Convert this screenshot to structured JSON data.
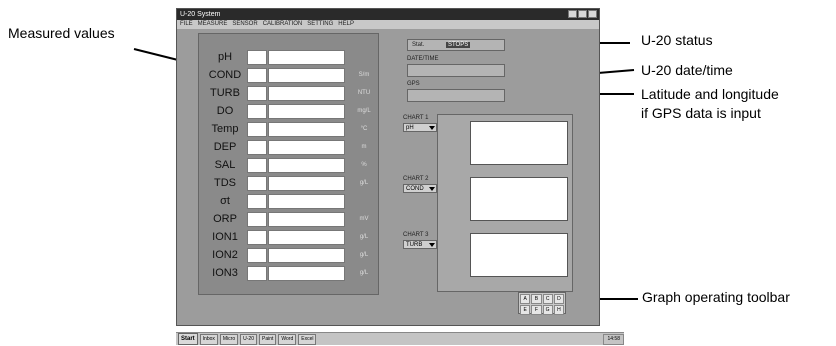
{
  "annotations": {
    "measured_values": "Measured values",
    "u20_status": "U-20 status",
    "u20_datetime": "U-20 date/time",
    "gps_line1": "Latitude and longitude",
    "gps_line2": "if GPS data is input",
    "toolbar": "Graph operating toolbar"
  },
  "window": {
    "title": "U-20 System",
    "menu": [
      "FILE",
      "MEASURE",
      "SENSOR",
      "CALIBRATION",
      "SETTING",
      "HELP"
    ]
  },
  "parameters": [
    {
      "label": "pH",
      "unit": ""
    },
    {
      "label": "COND",
      "unit": "S/m"
    },
    {
      "label": "TURB",
      "unit": "NTU"
    },
    {
      "label": "DO",
      "unit": "mg/L"
    },
    {
      "label": "Temp",
      "unit": "°C"
    },
    {
      "label": "DEP",
      "unit": "m"
    },
    {
      "label": "SAL",
      "unit": "%"
    },
    {
      "label": "TDS",
      "unit": "g/L"
    },
    {
      "label": "σt",
      "unit": ""
    },
    {
      "label": "ORP",
      "unit": "mV"
    },
    {
      "label": "ION1",
      "unit": "g/L"
    },
    {
      "label": "ION2",
      "unit": "g/L"
    },
    {
      "label": "ION3",
      "unit": "g/L"
    }
  ],
  "status": {
    "label": "Stat.",
    "value": "STOPS",
    "datetime_label": "DATE/TIME",
    "gps_label": "GPS"
  },
  "charts": [
    {
      "label": "CHART 1",
      "selected": "pH"
    },
    {
      "label": "CHART 2",
      "selected": "COND"
    },
    {
      "label": "CHART 3",
      "selected": "TURB"
    }
  ],
  "toolbar": {
    "buttons": [
      "A",
      "B",
      "C",
      "D",
      "E",
      "F",
      "G",
      "H"
    ]
  },
  "taskbar": {
    "start": "Start",
    "tasks": [
      "Inbox",
      "Micro",
      "U-20",
      "Paint",
      "Word",
      "Excel"
    ],
    "clock": "14:58"
  }
}
